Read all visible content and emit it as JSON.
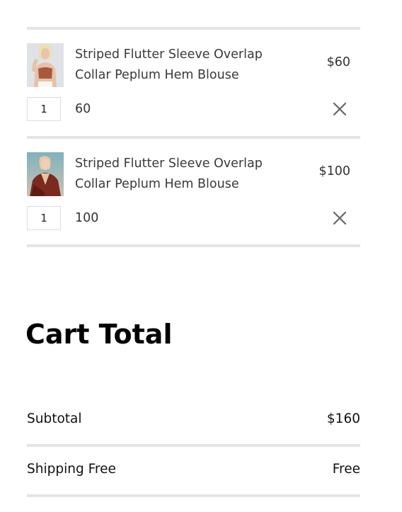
{
  "cart": {
    "items": [
      {
        "name_line1": "Striped Flutter Sleeve Overlap",
        "name_line2": "Collar Peplum Hem Blouse",
        "price": "$60",
        "quantity": "1",
        "subtotal": "60",
        "image_icon": "blonde-model-product-photo"
      },
      {
        "name_line1": "Striped Flutter Sleeve Overlap",
        "name_line2": "Collar Peplum Hem Blouse",
        "price": "$100",
        "quantity": "1",
        "subtotal": "100",
        "image_icon": "model-in-red-top-product-photo"
      }
    ],
    "remove_icon": "close-icon"
  },
  "totals": {
    "title": "Cart Total",
    "subtotal_label": "Subtotal",
    "subtotal_value": "$160",
    "shipping_label": "Shipping Free",
    "shipping_value": "Free"
  },
  "colors": {
    "divider": "#e4e4e4",
    "text": "#333333",
    "heading": "#000000",
    "remove_icon": "#666666"
  }
}
